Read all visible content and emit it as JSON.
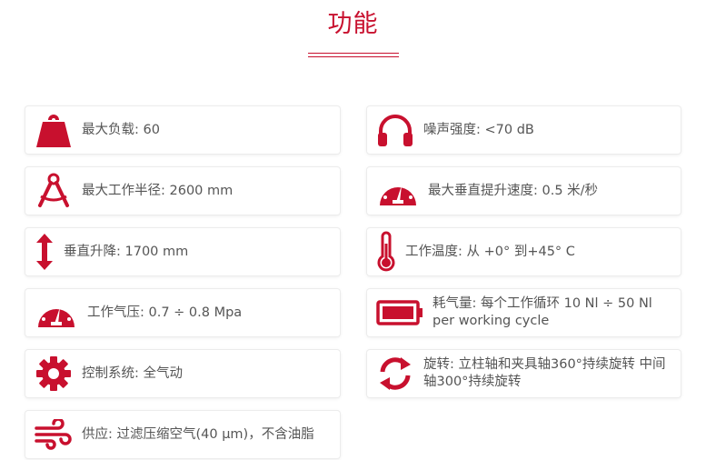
{
  "section": {
    "title": "功能"
  },
  "features": {
    "load": "最大负载: 60",
    "radius": "最大工作半径: 2600 mm",
    "lift": "垂直升降: 1700 mm",
    "pressure": "工作气压: 0.7 ÷ 0.8 Mpa",
    "control": "控制系统: 全气动",
    "supply": "供应: 过滤压缩空气(40 μm)，不含油脂",
    "noise": "噪声强度: <70 dB",
    "speed": "最大垂直提升速度: 0.5 米/秒",
    "temperature": "工作温度: 从 +0° 到+45° C",
    "consumption": "耗气量: 每个工作循环 10 Nl ÷ 50 Nl per working cycle",
    "rotation": "旋转: 立柱轴和夹具轴360°持续旋转 中间轴300°持续旋转"
  },
  "colors": {
    "accent": "#c8102e",
    "text": "#555555"
  },
  "icons": [
    "weight-icon",
    "compass-icon",
    "vertical-arrow-icon",
    "gauge-icon",
    "gear-icon",
    "wind-icon",
    "headphones-icon",
    "speedometer-icon",
    "thermometer-icon",
    "battery-icon",
    "rotate-icon"
  ]
}
